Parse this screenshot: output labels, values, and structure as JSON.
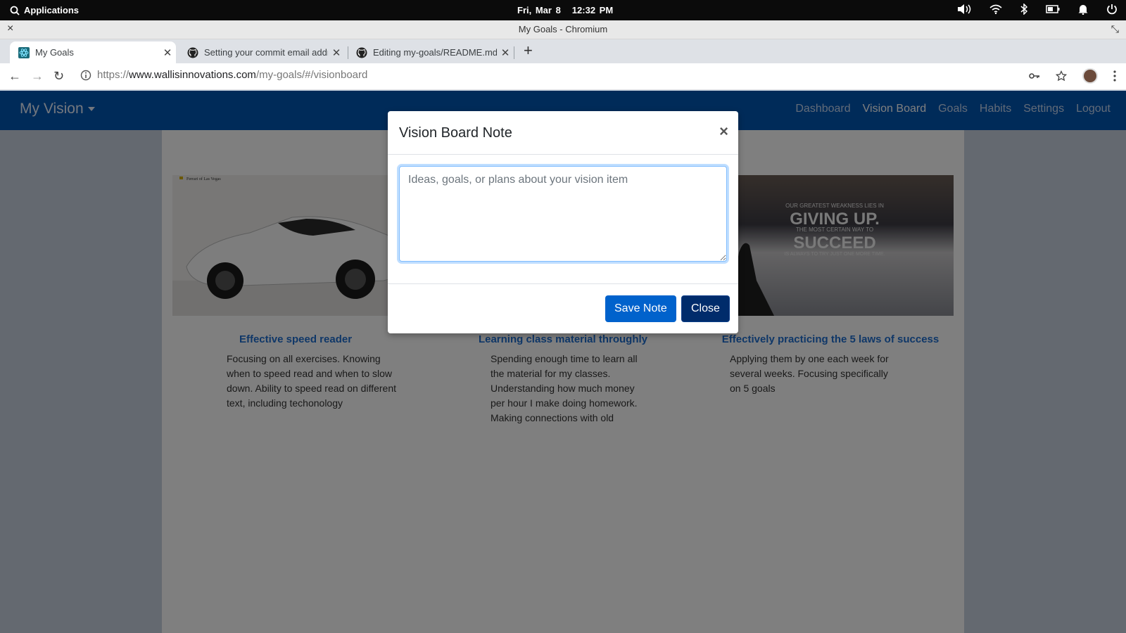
{
  "system_bar": {
    "applications_label": "Applications",
    "date": "Fri, Mar 8",
    "time": "12:32 PM"
  },
  "window": {
    "title": "My Goals - Chromium"
  },
  "tabs": [
    {
      "title": "My Goals",
      "favicon": "react-icon",
      "active": true
    },
    {
      "title": "Setting your commit email addr",
      "favicon": "github-icon",
      "active": false
    },
    {
      "title": "Editing my-goals/README.md a",
      "favicon": "github-icon",
      "active": false
    }
  ],
  "address": {
    "scheme": "https://",
    "domain": "www.wallisinnovations.com",
    "path": "/my-goals/#/visionboard"
  },
  "app": {
    "brand": "My Vision",
    "nav": [
      {
        "label": "Dashboard",
        "active": false
      },
      {
        "label": "Vision Board",
        "active": true
      },
      {
        "label": "Goals",
        "active": false
      },
      {
        "label": "Habits",
        "active": false
      },
      {
        "label": "Settings",
        "active": false
      },
      {
        "label": "Logout",
        "active": false
      }
    ]
  },
  "cards": [
    {
      "title": "Effective speed reader",
      "text": "Focusing on all exercises. Knowing when to speed read and when to slow down. Ability to speed read on different text, including techonology",
      "image_caption": "Ferrari of Las Vegas"
    },
    {
      "title": "Learning class material throughly",
      "text": "Spending enough time to learn all the material for my classes. Understanding how much money per hour I make doing homework. Making connections with old"
    },
    {
      "title": "Effectively practicing the 5 laws of success",
      "text": "Applying them by one each week for several weeks. Focusing specifically on 5 goals",
      "image_text": {
        "line1": "OUR GREATEST WEAKNESS LIES IN",
        "line2": "GIVING UP.",
        "line3": "THE MOST CERTAIN WAY TO",
        "line4": "SUCCEED",
        "line5": "IS ALWAYS TO TRY JUST ONE MORE TIME."
      }
    }
  ],
  "modal": {
    "title": "Vision Board Note",
    "close_symbol": "×",
    "textarea_placeholder": "Ideas, goals, or plans about your vision item",
    "textarea_value": "",
    "save_label": "Save Note",
    "close_label": "Close"
  },
  "colors": {
    "navbar": "#0056b3",
    "primary_button": "#0062cc",
    "dark_button": "#002c6b",
    "card_title": "#1f6fd0"
  }
}
